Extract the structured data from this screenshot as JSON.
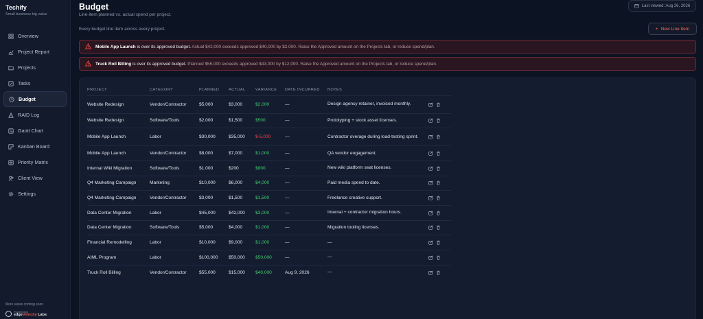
{
  "app": {
    "name": "Techify",
    "tagline": "Small business big value"
  },
  "sidebar": {
    "items": [
      {
        "label": "Overview",
        "icon": "grid-icon"
      },
      {
        "label": "Project Report",
        "icon": "chart-icon"
      },
      {
        "label": "Projects",
        "icon": "folder-icon"
      },
      {
        "label": "Tasks",
        "icon": "checkbox-icon"
      },
      {
        "label": "Budget",
        "icon": "clock-icon",
        "active": true
      },
      {
        "label": "RAID Log",
        "icon": "warning-icon"
      },
      {
        "label": "Gantt Chart",
        "icon": "gantt-icon"
      },
      {
        "label": "Kanban Board",
        "icon": "kanban-icon"
      },
      {
        "label": "Priority Matrix",
        "icon": "matrix-icon"
      },
      {
        "label": "Client View",
        "icon": "users-icon"
      },
      {
        "label": "Settings",
        "icon": "gear-icon"
      }
    ],
    "footer": "More views coming soon",
    "powered_by": "Powered by",
    "powered_brand_a": "edge",
    "powered_brand_b": "Velocity",
    "powered_brand_c": " Labs"
  },
  "header": {
    "title": "Budget",
    "subtitle": "Line-item planned vs. actual spend per project.",
    "last_viewed": "Last viewed: Aug 26, 2026",
    "description": "Every budget line item across every project.",
    "new_button": "New Line Item"
  },
  "alerts": [
    {
      "project": "Mobile App Launch",
      "strong": " is over its approved budget.",
      "detail": " Actual $42,000 exceeds approved $40,000 by $2,000. Raise the Approved amount on the Projects tab, or reduce spend/plan."
    },
    {
      "project": "Truck Roll Billing",
      "strong": " is over its approved budget.",
      "detail": " Planned $55,000 exceeds approved $43,000 by $12,000. Raise the Approved amount on the Projects tab, or reduce spend/plan."
    }
  ],
  "table": {
    "columns": [
      "PROJECT",
      "CATEGORY",
      "PLANNED",
      "ACTUAL",
      "VARIANCE",
      "DATE INCURRED",
      "NOTES"
    ],
    "rows": [
      {
        "project": "Website Redesign",
        "category": "Vendor/Contractor",
        "planned": "$5,000",
        "actual": "$3,000",
        "variance": "$2,000",
        "date": "—",
        "notes": "Design agency retainer, invoiced monthly."
      },
      {
        "project": "Website Redesign",
        "category": "Software/Tools",
        "planned": "$2,000",
        "actual": "$1,500",
        "variance": "$500",
        "date": "—",
        "notes": "Prototyping + stock asset licenses."
      },
      {
        "project": "Mobile App Launch",
        "category": "Labor",
        "planned": "$30,000",
        "actual": "$35,000",
        "variance": "$-5,000",
        "date": "—",
        "notes": "Contractor overage during load-testing sprint."
      },
      {
        "project": "Mobile App Launch",
        "category": "Vendor/Contractor",
        "planned": "$8,000",
        "actual": "$7,000",
        "variance": "$1,000",
        "date": "—",
        "notes": "QA vendor engagement."
      },
      {
        "project": "Internal Wiki Migration",
        "category": "Software/Tools",
        "planned": "$1,000",
        "actual": "$200",
        "variance": "$800",
        "date": "—",
        "notes": "New wiki platform seat licenses."
      },
      {
        "project": "Q4 Marketing Campaign",
        "category": "Marketing",
        "planned": "$10,000",
        "actual": "$6,000",
        "variance": "$4,000",
        "date": "—",
        "notes": "Paid media spend to date."
      },
      {
        "project": "Q4 Marketing Campaign",
        "category": "Vendor/Contractor",
        "planned": "$3,000",
        "actual": "$1,500",
        "variance": "$1,500",
        "date": "—",
        "notes": "Freelance creative support."
      },
      {
        "project": "Data Center Migration",
        "category": "Labor",
        "planned": "$45,000",
        "actual": "$42,000",
        "variance": "$3,000",
        "date": "—",
        "notes": "Internal + contractor migration hours."
      },
      {
        "project": "Data Center Migration",
        "category": "Software/Tools",
        "planned": "$5,000",
        "actual": "$4,000",
        "variance": "$1,000",
        "date": "—",
        "notes": "Migration tooling licenses."
      },
      {
        "project": "Financial Remodelling",
        "category": "Labor",
        "planned": "$10,000",
        "actual": "$9,000",
        "variance": "$1,000",
        "date": "—",
        "notes": "—"
      },
      {
        "project": "AIML Program",
        "category": "Labor",
        "planned": "$100,000",
        "actual": "$50,000",
        "variance": "$50,000",
        "date": "—",
        "notes": "—"
      },
      {
        "project": "Truck Roll Billing",
        "category": "Vendor/Contractor",
        "planned": "$55,000",
        "actual": "$15,000",
        "variance": "$40,000",
        "date": "Aug 9, 2026",
        "notes": "—"
      }
    ]
  },
  "colors": {
    "accent": "#f26b5e",
    "positive": "#3fcf6f",
    "negative": "#f0473f",
    "alert_bg": "#2a1621"
  }
}
